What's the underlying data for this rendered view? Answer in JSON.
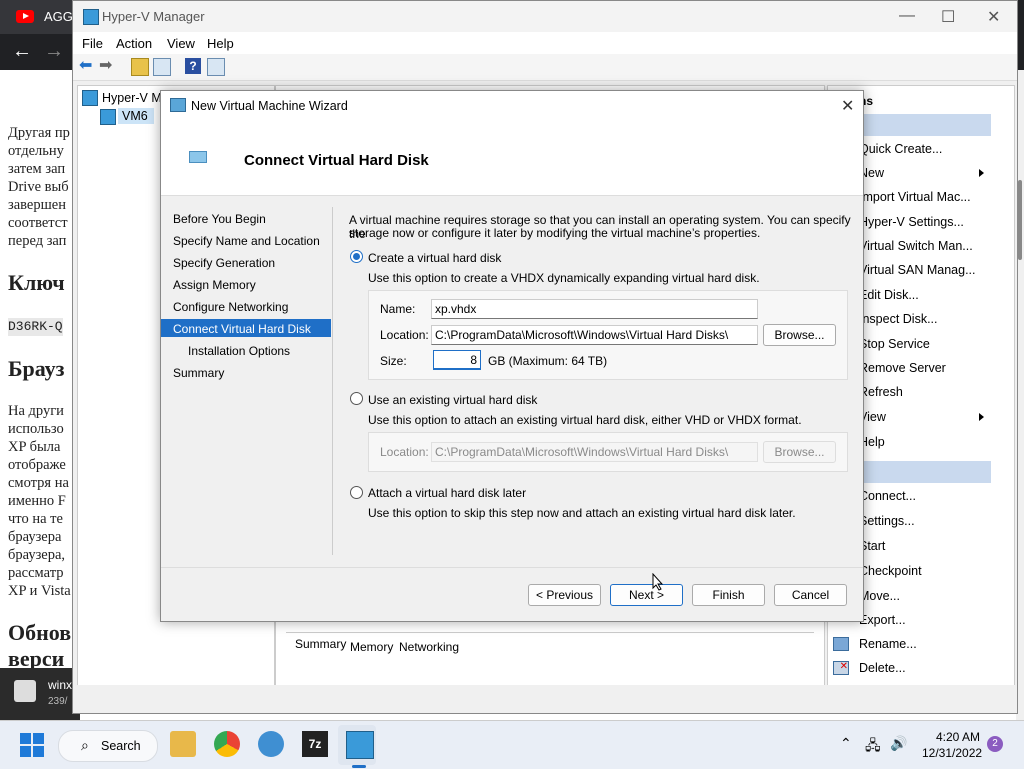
{
  "browser": {
    "tab_text": "AGGI",
    "page_lines": [
      "Другая пр",
      "отдельну",
      "затем зап",
      "Drive выб",
      "завершен",
      "соответст",
      "перед зап"
    ],
    "heading1": "Ключ",
    "code": "D36RK-Q",
    "heading2": "Брауз",
    "page_lines2": [
      "На други",
      "использо",
      "XP была",
      "отображе",
      "смотря на",
      "именно F",
      "что на те",
      "браузера",
      "браузера,",
      "рассматр",
      "XP и Vista"
    ],
    "heading3": "Обнов",
    "heading3b": "верси",
    "download_text": "winx",
    "download_sub": "239/"
  },
  "hyperv": {
    "title": "Hyper-V Manager",
    "menu": [
      "File",
      "Action",
      "View",
      "Help"
    ],
    "tree_root": "Hyper-V M",
    "tree_child": "VM6",
    "actions_header": "ns",
    "actions": [
      "Quick Create...",
      "New",
      "Import Virtual Mac...",
      "Hyper-V Settings...",
      "Virtual Switch Man...",
      "Virtual SAN Manag...",
      "Edit Disk...",
      "Inspect Disk...",
      "Stop Service",
      "Remove Server",
      "Refresh",
      "View",
      "Help"
    ],
    "vm_actions": [
      "Connect...",
      "Settings...",
      "Start",
      "Checkpoint",
      "Move...",
      "Export...",
      "Rename...",
      "Delete..."
    ],
    "tabs": [
      "Summary",
      "Memory",
      "Networking"
    ]
  },
  "wizard": {
    "title": "New Virtual Machine Wizard",
    "heading": "Connect Virtual Hard Disk",
    "steps": [
      "Before You Begin",
      "Specify Name and Location",
      "Specify Generation",
      "Assign Memory",
      "Configure Networking",
      "Connect Virtual Hard Disk",
      "Installation Options",
      "Summary"
    ],
    "intro_line1": "A virtual machine requires storage so that you can install an operating system. You can specify the",
    "intro_line2": "storage now or configure it later by modifying the virtual machine’s properties.",
    "opt_create": "Create a virtual hard disk",
    "opt_create_desc": "Use this option to create a VHDX dynamically expanding virtual hard disk.",
    "name_label": "Name:",
    "name_value": "xp.vhdx",
    "location_label": "Location:",
    "location_value": "C:\\ProgramData\\Microsoft\\Windows\\Virtual Hard Disks\\",
    "browse": "Browse...",
    "size_label": "Size:",
    "size_value": "8",
    "size_hint": "GB (Maximum: 64 TB)",
    "opt_existing": "Use an existing virtual hard disk",
    "opt_existing_desc": "Use this option to attach an existing virtual hard disk, either VHD or VHDX format.",
    "existing_location_label": "Location:",
    "existing_location_value": "C:\\ProgramData\\Microsoft\\Windows\\Virtual Hard Disks\\",
    "opt_later": "Attach a virtual hard disk later",
    "opt_later_desc": "Use this option to skip this step now and attach an existing virtual hard disk later.",
    "btn_previous": "< Previous",
    "btn_next": "Next >",
    "btn_finish": "Finish",
    "btn_cancel": "Cancel"
  },
  "taskbar": {
    "search": "Search",
    "time": "4:20 AM",
    "date": "12/31/2022",
    "notifications": "2"
  }
}
